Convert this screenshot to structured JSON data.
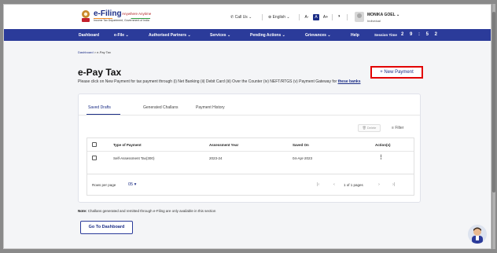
{
  "header": {
    "logo_title": "e-Filing",
    "logo_tagline": "Anywhere Anytime",
    "logo_subtitle": "Income Tax Department, Government of India",
    "call_us": "Call Us",
    "language": "English",
    "font_small": "A-",
    "font_normal": "A",
    "font_large": "A+",
    "contrast_icon": "contrast-icon",
    "user_name": "MONIKA GOEL",
    "user_role": "Individual"
  },
  "nav": {
    "items": [
      {
        "label": "Dashboard"
      },
      {
        "label": "e-File"
      },
      {
        "label": "Authorised Partners"
      },
      {
        "label": "Services"
      },
      {
        "label": "Pending Actions"
      },
      {
        "label": "Grievances"
      },
      {
        "label": "Help"
      }
    ],
    "session_label": "Session Time",
    "session_time": "2 9 : 5 2"
  },
  "breadcrumb": {
    "home": "Dashboard",
    "separator": ">",
    "current": "e-Pay Tax"
  },
  "page": {
    "title": "e-Pay Tax",
    "description": "Please click on New Payment for tax payment through (i) Net Banking (ii) Debit Card (iii) Over the Counter (iv) NEFT/RTGS (v) Payment Gateway for",
    "description_link": "these banks",
    "new_payment_label": "+ New Payment"
  },
  "tabs": [
    {
      "label": "Saved Drafts",
      "active": true
    },
    {
      "label": "Generated Challans",
      "active": false
    },
    {
      "label": "Payment History",
      "active": false
    }
  ],
  "toolbar": {
    "delete_label": "Delete",
    "filter_label": "Filter"
  },
  "table": {
    "columns": [
      "Type of Payment",
      "Assessment Year",
      "Saved On",
      "Action(s)"
    ],
    "rows": [
      {
        "type": "Self-Assessment Tax(300)",
        "year": "2023-24",
        "saved_on": "04-Apr-2023",
        "action": "⋮"
      }
    ]
  },
  "pagination": {
    "rows_per_page_label": "Rows per page",
    "rows_per_page_value": "05",
    "page_info": "1 of 1 pages",
    "first": "|‹",
    "prev": "‹",
    "next": "›",
    "last": "›|"
  },
  "note": {
    "label": "Note:",
    "text": "Challans generated and remitted through e-Filing are only available in this section"
  },
  "footer": {
    "dashboard_button": "Go To Dashboard"
  },
  "colors": {
    "nav_bg": "#2b3b9a",
    "accent": "#1b2d86",
    "highlight": "#e20000"
  }
}
